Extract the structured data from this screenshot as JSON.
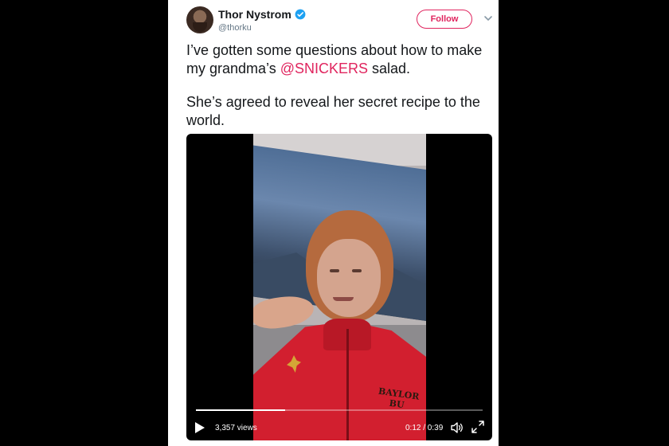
{
  "author": {
    "display_name": "Thor Nystrom",
    "handle": "@thorku",
    "verified": true
  },
  "follow_button": {
    "label": "Follow"
  },
  "tweet": {
    "line1_before": "I’ve gotten some questions about how to make my grandma’s ",
    "mention": "@SNICKERS",
    "line1_after": " salad.",
    "paragraph2": "She’s agreed to reveal her secret recipe to the world."
  },
  "video": {
    "views": "3,357 views",
    "time": "0:12 / 0:39",
    "progress_fraction": 0.31,
    "jacket_text": "BAYLOR BU"
  },
  "colors": {
    "accent": "#e0245e",
    "verified": "#1da1f2",
    "background": "#000000"
  },
  "icons": [
    "verified-badge-icon",
    "chevron-down-icon",
    "play-icon",
    "volume-icon",
    "fullscreen-icon"
  ]
}
